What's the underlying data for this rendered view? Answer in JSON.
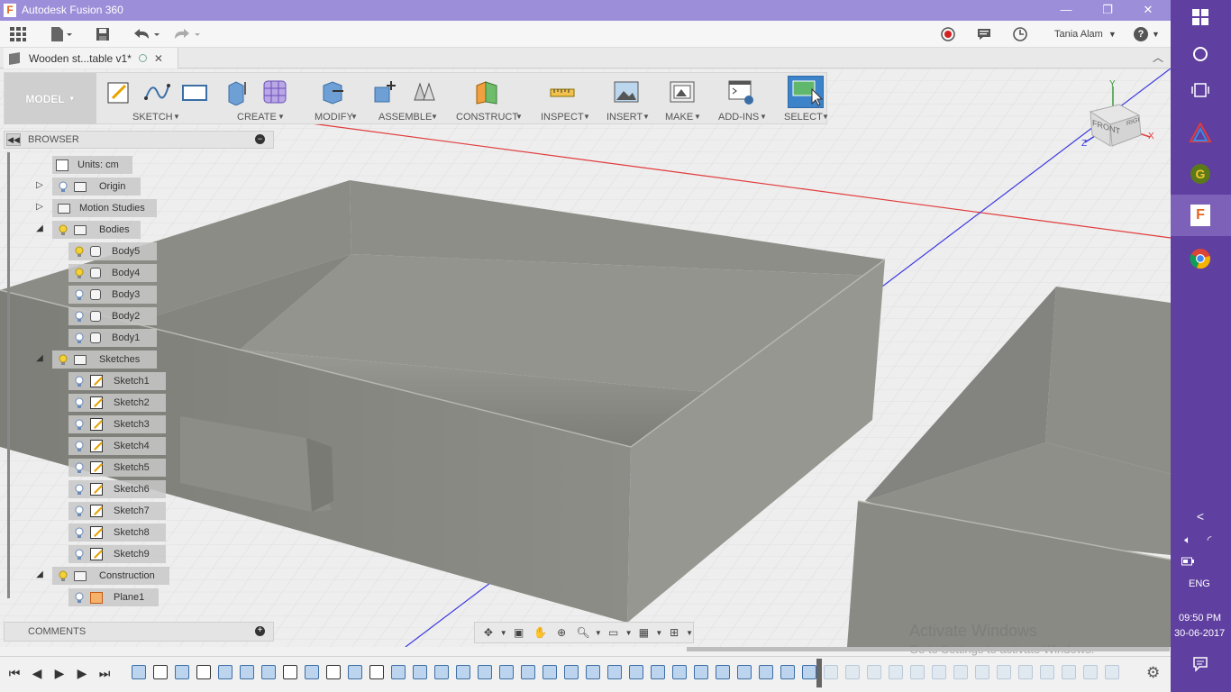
{
  "window": {
    "title": "Autodesk Fusion 360",
    "logo_letter": "F",
    "minimize": "—",
    "restore": "❐",
    "close": "✕"
  },
  "menubar": {
    "user_name": "Tania Alam",
    "help": "?"
  },
  "document_tab": {
    "title": "Wooden st...table v1*"
  },
  "toolbar": {
    "workspace": "MODEL",
    "groups": [
      {
        "label": "SKETCH"
      },
      {
        "label": "CREATE"
      },
      {
        "label": "MODIFY"
      },
      {
        "label": "ASSEMBLE"
      },
      {
        "label": "CONSTRUCT"
      },
      {
        "label": "INSPECT"
      },
      {
        "label": "INSERT"
      },
      {
        "label": "MAKE"
      },
      {
        "label": "ADD-INS"
      },
      {
        "label": "SELECT"
      }
    ]
  },
  "browser": {
    "title": "BROWSER",
    "items": [
      {
        "label": "Units: cm"
      },
      {
        "label": "Origin"
      },
      {
        "label": "Motion Studies"
      },
      {
        "label": "Bodies"
      },
      {
        "label": "Body5"
      },
      {
        "label": "Body4"
      },
      {
        "label": "Body3"
      },
      {
        "label": "Body2"
      },
      {
        "label": "Body1"
      },
      {
        "label": "Sketches"
      },
      {
        "label": "Sketch1"
      },
      {
        "label": "Sketch2"
      },
      {
        "label": "Sketch3"
      },
      {
        "label": "Sketch4"
      },
      {
        "label": "Sketch5"
      },
      {
        "label": "Sketch6"
      },
      {
        "label": "Sketch7"
      },
      {
        "label": "Sketch8"
      },
      {
        "label": "Sketch9"
      },
      {
        "label": "Construction"
      },
      {
        "label": "Plane1"
      }
    ]
  },
  "comments": {
    "title": "COMMENTS"
  },
  "viewcube": {
    "front": "FRONT",
    "right": "RIGHT",
    "axis_x": "X",
    "axis_y": "Y",
    "axis_z": "Z"
  },
  "watermark": {
    "line1": "Activate Windows",
    "line2": "Go to Settings to activate Windows."
  },
  "taskbar": {
    "language": "ENG",
    "time": "09:50 PM",
    "date": "30-06-2017"
  },
  "colors": {
    "titlebar": "#9c8ed8",
    "taskbar": "#5f3fa0",
    "select_active": "#3d83c9",
    "body_gray": "#8a8a84"
  }
}
